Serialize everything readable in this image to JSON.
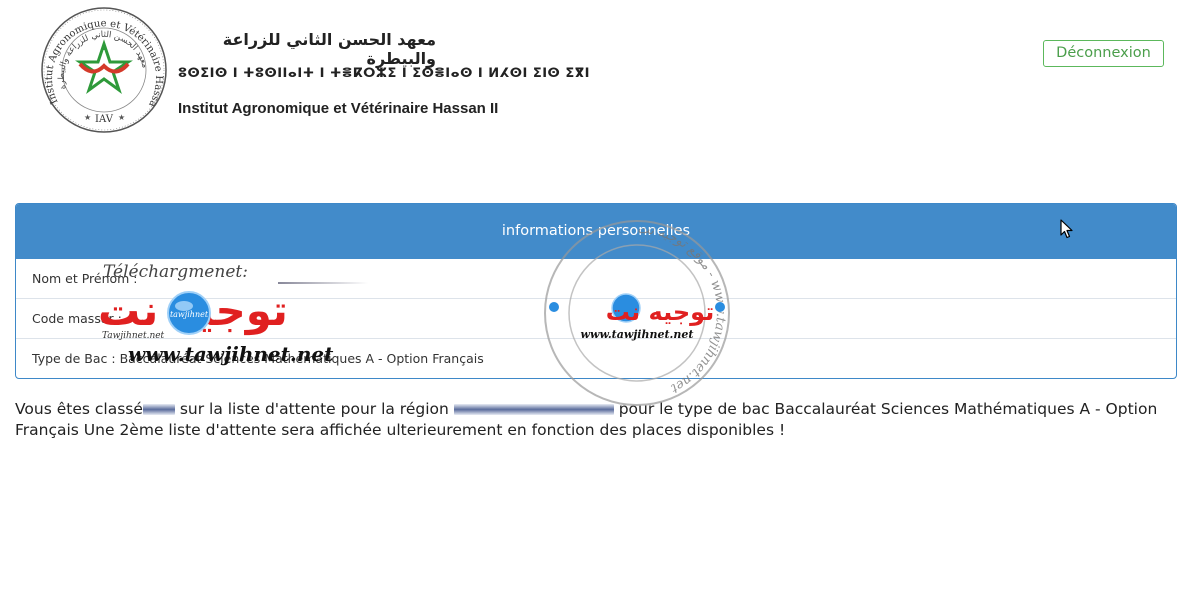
{
  "header": {
    "institute_name_ar": "معهد الحسن الثاني للزراعة والبيطرة",
    "institute_name_tz": "ⵓⵙⵉⵏⵙ ⵏ ⵜⵓⵙⵏⵏⴰⵏⵜ ⵏ ⵜⴻⴽⵔⵣⵉ ⵏ ⵉⵙⴻⵏⴰⵙ ⵏ ⵍⵃⵙⵏ ⵉⵏⵙ ⵉⴳⵏ",
    "institute_name_fr": "Institut Agronomique et Vétérinaire Hassan II",
    "seal": {
      "text_fr": "Institut Agronomique et Vétérinaire Hassan II",
      "text_ar": "معهد الحسن الثاني للزراعة والبيطرة",
      "abbr": "IAV"
    },
    "logout_label": "Déconnexion"
  },
  "panel": {
    "title": "informations personnelles",
    "rows": [
      {
        "label": "Nom et Prénom :",
        "value": ""
      },
      {
        "label": "Code massar :",
        "value": ""
      },
      {
        "label": "Type de Bac :",
        "value": "Baccalauréat Sciences Mathématiques A - Option Français"
      }
    ]
  },
  "message": {
    "part1": "Vous êtes classé",
    "part2": "sur la liste d'attente pour la région",
    "part3": "pour le type de bac Baccalauréat Sciences Mathématiques A - Option Français Une 2ème liste d'attente sera affichée ulterieurement en fonction des places disponibles !"
  },
  "watermark": {
    "caption": "Téléchargmenet:",
    "brand_ar": "توجيه نت",
    "logo_text": "tawjihnet",
    "brand_small": "Tawjihnet.net",
    "url": "www.tawjihnet.net",
    "stamp_ring": "موقع توجيه نت - www.tawjihnet.net"
  },
  "colors": {
    "panel_heading": "#428bca",
    "logout_border": "#5cb85c",
    "watermark_red": "#e02020"
  }
}
